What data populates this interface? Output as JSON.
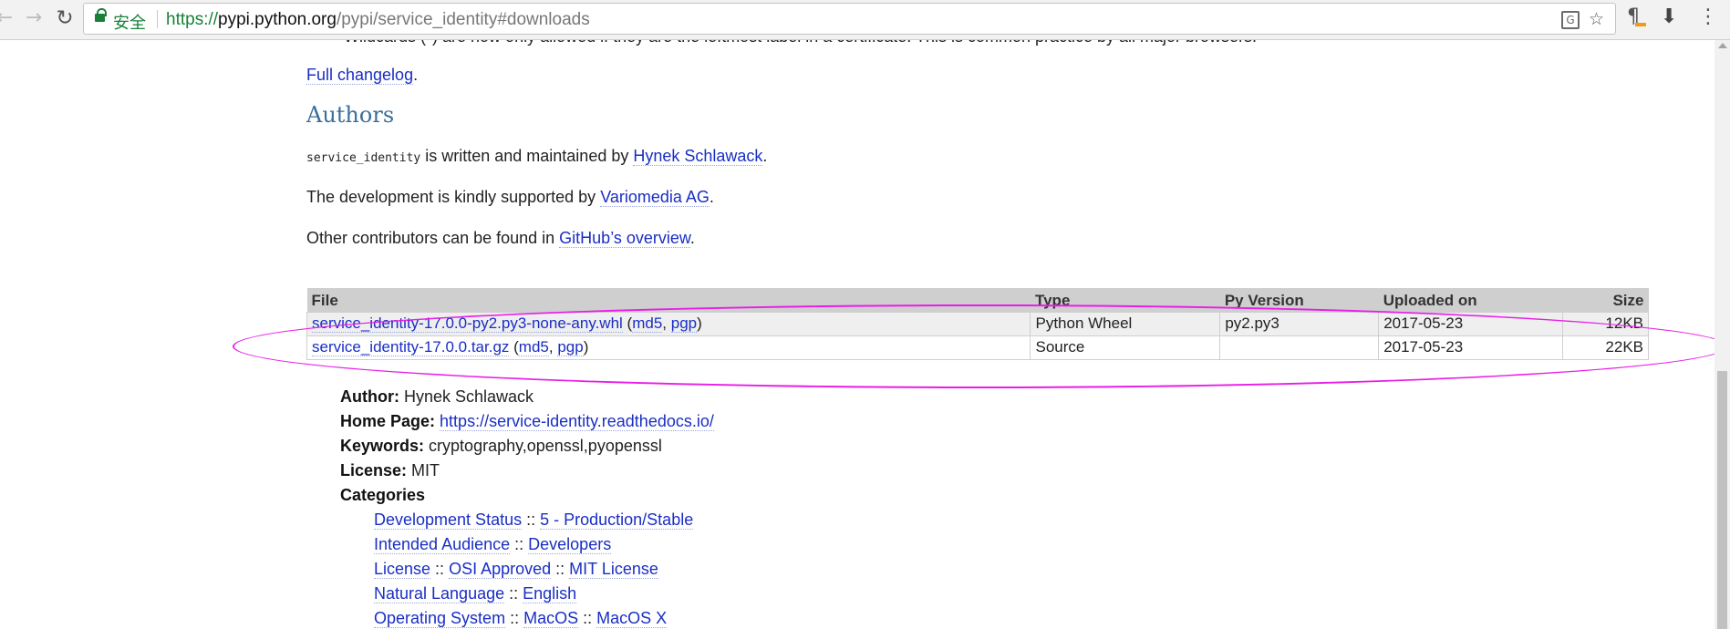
{
  "browser": {
    "secure_label": "安全",
    "url_scheme": "https://",
    "url_host": "pypi.python.org",
    "url_path": "/pypi/service_identity#downloads",
    "translate_glyph": "G"
  },
  "content": {
    "full_changelog": "Full changelog",
    "authors_heading": "Authors",
    "authors_line": {
      "code": "service_identity",
      "text": " is written and maintained by ",
      "link": "Hynek Schlawack"
    },
    "support_line": {
      "text": "The development is kindly supported by ",
      "link": "Variomedia AG"
    },
    "contributors_line": {
      "text": "Other contributors can be found in ",
      "link": "GitHub’s overview"
    }
  },
  "downloads": {
    "headers": [
      "File",
      "Type",
      "Py Version",
      "Uploaded on",
      "Size"
    ],
    "rows": [
      {
        "file": "service_identity-17.0.0-py2.py3-none-any.whl",
        "md5": "md5",
        "pgp": "pgp",
        "type": "Python Wheel",
        "py_version": "py2.py3",
        "uploaded": "2017-05-23",
        "size": "12KB"
      },
      {
        "file": "service_identity-17.0.0.tar.gz",
        "md5": "md5",
        "pgp": "pgp",
        "type": "Source",
        "py_version": "",
        "uploaded": "2017-05-23",
        "size": "22KB"
      }
    ]
  },
  "meta": {
    "author_label": "Author:",
    "author_value": "Hynek Schlawack",
    "homepage_label": "Home Page:",
    "homepage_value": "https://service-identity.readthedocs.io/",
    "keywords_label": "Keywords:",
    "keywords_value": "cryptography,openssl,pyopenssl",
    "license_label": "License:",
    "license_value": "MIT",
    "categories_label": "Categories",
    "categories": [
      [
        "Development Status",
        "5 - Production/Stable"
      ],
      [
        "Intended Audience",
        "Developers"
      ],
      [
        "License",
        "OSI Approved",
        "MIT License"
      ],
      [
        "Natural Language",
        "English"
      ],
      [
        "Operating System",
        "MacOS",
        "MacOS X"
      ]
    ]
  },
  "colors": {
    "link": "#1a2ec4",
    "heading": "#3b6e9a",
    "annotation": "#e81de8",
    "secure": "#188038"
  }
}
